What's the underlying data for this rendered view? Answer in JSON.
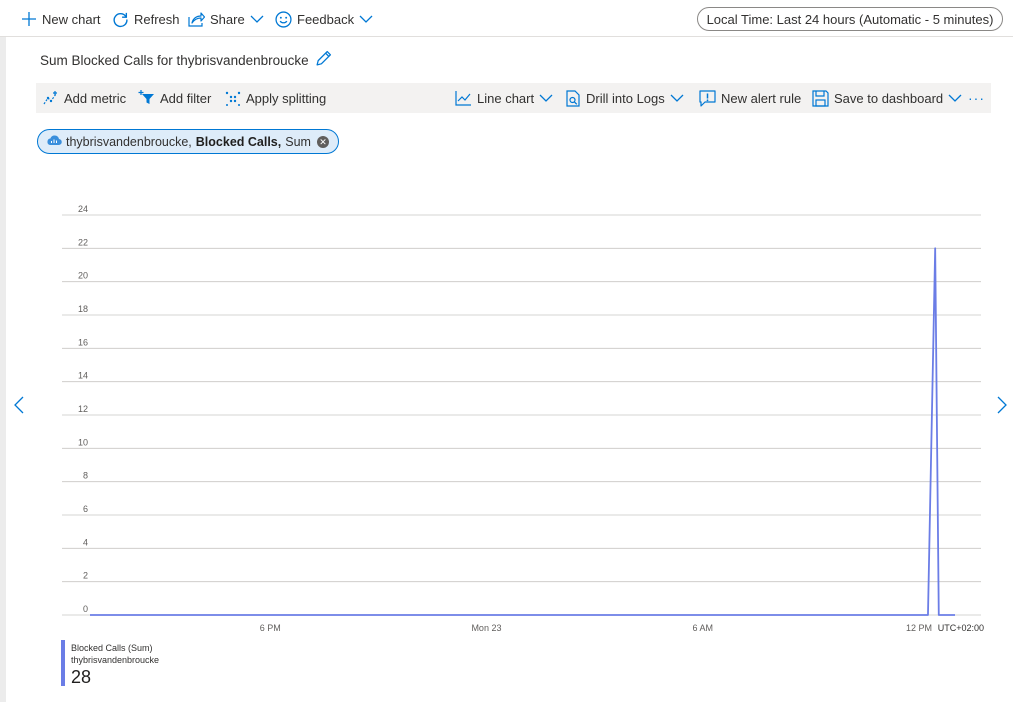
{
  "topbar": {
    "new_chart": "New chart",
    "refresh": "Refresh",
    "share": "Share",
    "feedback": "Feedback",
    "time_range": "Local Time: Last 24 hours (Automatic - 5 minutes)"
  },
  "chart_header": {
    "title": "Sum Blocked Calls for thybrisvandenbroucke"
  },
  "toolbar": {
    "add_metric": "Add metric",
    "add_filter": "Add filter",
    "apply_splitting": "Apply splitting",
    "line_chart": "Line chart",
    "drill_into_logs": "Drill into Logs",
    "new_alert_rule": "New alert rule",
    "save_to_dashboard": "Save to dashboard",
    "more": "···"
  },
  "metric_pill": {
    "resource": "thybrisvandenbroucke,",
    "metric": "Blocked Calls,",
    "aggregation": "Sum"
  },
  "legend": {
    "series_name": "Blocked Calls (Sum)",
    "resource": "thybrisvandenbroucke",
    "value": "28"
  },
  "colors": {
    "accent": "#0078d4",
    "series": "#6b7de6",
    "grid": "#c8c6c4"
  },
  "chart_data": {
    "type": "line",
    "ylim": [
      0,
      24
    ],
    "yticks": [
      "0",
      "2",
      "4",
      "6",
      "8",
      "10",
      "12",
      "14",
      "16",
      "18",
      "20",
      "22",
      "24"
    ],
    "xlim": [
      0,
      24
    ],
    "xticks": [
      {
        "label": "6 PM",
        "x": 5
      },
      {
        "label": "Mon 23",
        "x": 11
      },
      {
        "label": "6 AM",
        "x": 17
      },
      {
        "label": "12 PM",
        "x": 23
      }
    ],
    "timezone": "UTC+02:00",
    "series": [
      {
        "name": "Blocked Calls (Sum)",
        "x": [
          0,
          23.25,
          23.45,
          23.55,
          24
        ],
        "y": [
          0,
          0,
          22,
          0,
          0
        ]
      }
    ]
  }
}
